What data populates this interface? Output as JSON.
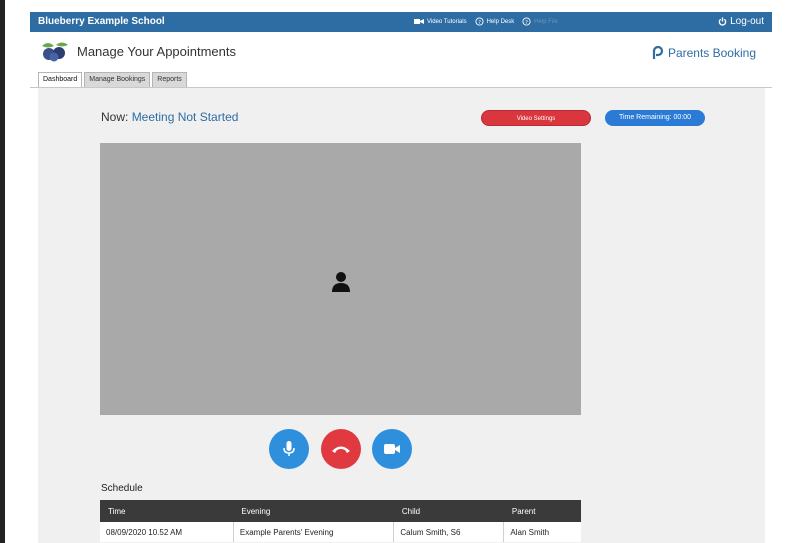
{
  "topbar": {
    "school": "Blueberry Example School",
    "video_tutorials": "Video Tutorials",
    "help_desk": "Help Desk",
    "help_file": "Help File",
    "logout": "Log-out"
  },
  "header": {
    "title": "Manage Your Appointments",
    "brand": "Parents Booking"
  },
  "tabs": [
    {
      "label": "Dashboard",
      "active": true
    },
    {
      "label": "Manage Bookings",
      "active": false
    },
    {
      "label": "Reports",
      "active": false
    }
  ],
  "meeting": {
    "now_label": "Now:",
    "status": "Meeting Not Started",
    "video_settings": "Video Settings",
    "time_remaining": "Time Remaining: 00:00"
  },
  "schedule": {
    "label": "Schedule",
    "columns": [
      "Time",
      "Evening",
      "Child",
      "Parent"
    ],
    "rows": [
      [
        "08/09/2020 10.52 AM",
        "Example Parents' Evening",
        "Calum Smith, S6",
        "Alan Smith"
      ]
    ]
  },
  "colors": {
    "topbar": "#2e6da4",
    "end_call": "#e03a40",
    "control_blue": "#2e8fdc",
    "video_bg": "#a9a9a9"
  },
  "icons": [
    "camera-icon",
    "help-icon",
    "power-icon",
    "person-icon",
    "microphone-icon",
    "phone-hangup-icon",
    "video-camera-icon",
    "blueberry-logo",
    "parents-booking-logo"
  ]
}
